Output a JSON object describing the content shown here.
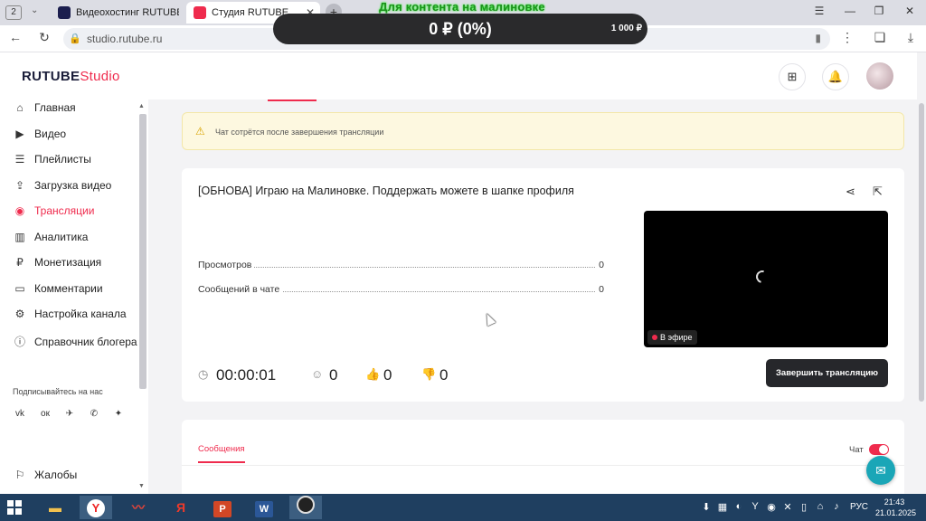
{
  "browser": {
    "tab_count": "2",
    "tabs": [
      {
        "label": "Видеохостинг RUTUBE. С"
      },
      {
        "label": "Студия RUTUBE"
      }
    ],
    "url": "studio.rutube.ru"
  },
  "overlay": {
    "title": "Для контента на малиновке",
    "amount": "0 ₽ (0%)",
    "goal": "1 000 ₽"
  },
  "app": {
    "logo_main": "RUTUBE",
    "logo_studio": "Studio"
  },
  "sidebar": {
    "items": [
      {
        "label": "Главная",
        "icon": "home-icon"
      },
      {
        "label": "Видео",
        "icon": "video-icon"
      },
      {
        "label": "Плейлисты",
        "icon": "playlist-icon"
      },
      {
        "label": "Загрузка видео",
        "icon": "upload-icon"
      },
      {
        "label": "Трансляции",
        "icon": "broadcast-icon"
      },
      {
        "label": "Аналитика",
        "icon": "analytics-icon"
      },
      {
        "label": "Монетизация",
        "icon": "ruble-icon"
      },
      {
        "label": "Комментарии",
        "icon": "comments-icon"
      },
      {
        "label": "Настройка канала",
        "icon": "gear-icon"
      },
      {
        "label": "Справочник блогера",
        "icon": "info-icon"
      }
    ],
    "active_index": 4,
    "follow_label": "Подписывайтесь на нас",
    "complaints": "Жалобы"
  },
  "warning": {
    "text": "Чат сотрётся после завершения трансляции"
  },
  "stream": {
    "title": "[ОБНОВА] Играю на Малиновке. Поддержать можете в шапке профиля",
    "stats": [
      {
        "label": "Просмотров",
        "value": "0"
      },
      {
        "label": "Сообщений в чате",
        "value": "0"
      }
    ],
    "live_label": "В эфире",
    "duration": "00:00:01",
    "viewers": "0",
    "likes": "0",
    "dislikes": "0",
    "end_button": "Завершить трансляцию"
  },
  "chat": {
    "tab_label": "Сообщения",
    "toggle_label": "Чат",
    "enabled": true
  },
  "taskbar": {
    "lang": "РУС",
    "time": "21:43",
    "date": "21.01.2025"
  },
  "colors": {
    "accent": "#ef2b4d",
    "button_dark": "#26272b",
    "help_fab": "#1aa6b7"
  }
}
